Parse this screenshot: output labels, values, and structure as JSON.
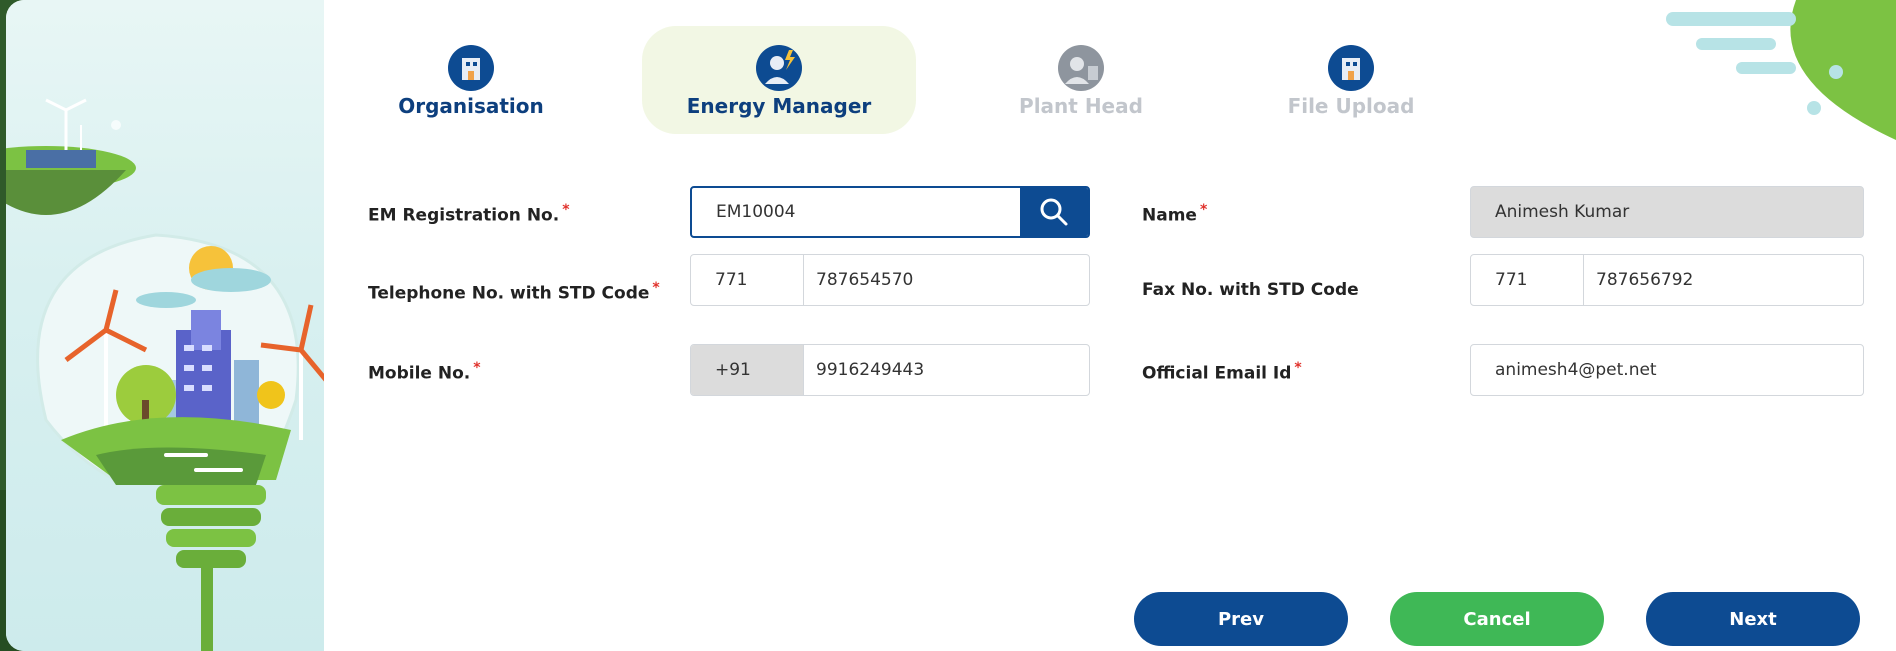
{
  "steps": [
    {
      "label": "Organisation",
      "state": "done",
      "icon": "organisation-building-icon"
    },
    {
      "label": "Energy Manager",
      "state": "active",
      "icon": "energy-manager-person-icon"
    },
    {
      "label": "Plant Head",
      "state": "disabled",
      "icon": "plant-head-person-icon"
    },
    {
      "label": "File Upload",
      "state": "disabled",
      "icon": "file-upload-building-icon"
    }
  ],
  "form": {
    "em_registration": {
      "label": "EM Registration No.",
      "required": "*",
      "value": "EM10004",
      "icon": "search-icon"
    },
    "name": {
      "label": "Name",
      "required": "*",
      "value": "Animesh Kumar"
    },
    "telephone": {
      "label": "Telephone No. with STD Code",
      "required": "*",
      "std_code": "771",
      "number": "787654570"
    },
    "fax": {
      "label": "Fax No. with STD Code",
      "std_code": "771",
      "number": "787656792"
    },
    "mobile": {
      "label": "Mobile No.",
      "required": "*",
      "country_code": "+91",
      "number": "9916249443"
    },
    "email": {
      "label": "Official Email Id",
      "required": "*",
      "value": "animesh4@pet.net"
    }
  },
  "buttons": {
    "prev": "Prev",
    "cancel": "Cancel",
    "next": "Next"
  },
  "colors": {
    "primary": "#0d4b92",
    "success": "#3fb856",
    "required": "#e0312b",
    "step_active_bg": "#f2f7e4"
  }
}
